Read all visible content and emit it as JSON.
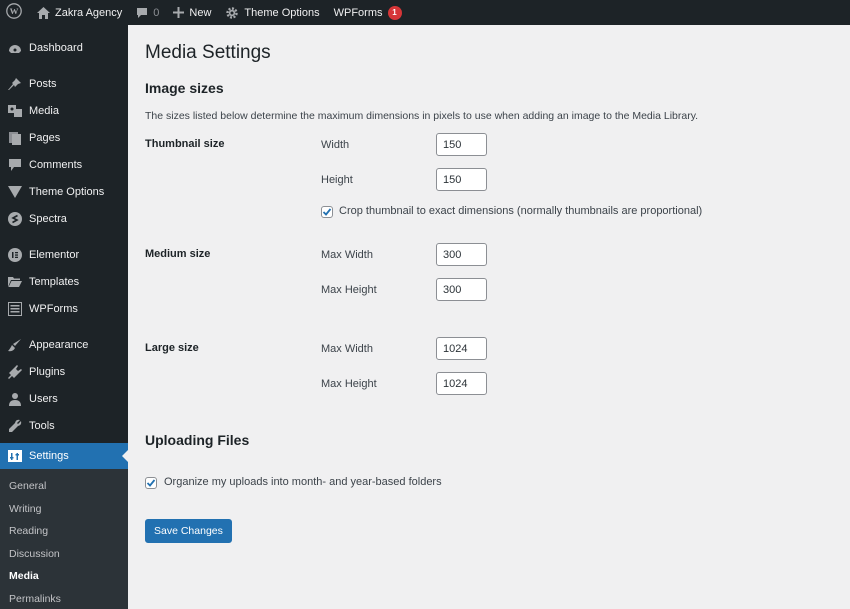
{
  "adminbar": {
    "site_name": "Zakra Agency",
    "comments_count": "0",
    "new_label": "New",
    "theme_options_label": "Theme Options",
    "wpforms_label": "WPForms",
    "wpforms_badge": "1"
  },
  "sidebar": {
    "items": [
      {
        "label": "Dashboard",
        "icon": "dashboard-icon"
      },
      {
        "label": "Posts",
        "icon": "pin-icon"
      },
      {
        "label": "Media",
        "icon": "media-icon"
      },
      {
        "label": "Pages",
        "icon": "pages-icon"
      },
      {
        "label": "Comments",
        "icon": "comment-icon"
      },
      {
        "label": "Theme Options",
        "icon": "triangle-icon"
      },
      {
        "label": "Spectra",
        "icon": "spectra-icon"
      },
      {
        "label": "Elementor",
        "icon": "elementor-icon"
      },
      {
        "label": "Templates",
        "icon": "folder-icon"
      },
      {
        "label": "WPForms",
        "icon": "form-icon"
      },
      {
        "label": "Appearance",
        "icon": "brush-icon"
      },
      {
        "label": "Plugins",
        "icon": "plug-icon"
      },
      {
        "label": "Users",
        "icon": "user-icon"
      },
      {
        "label": "Tools",
        "icon": "wrench-icon"
      },
      {
        "label": "Settings",
        "icon": "settings-icon"
      }
    ],
    "submenu": [
      "General",
      "Writing",
      "Reading",
      "Discussion",
      "Media",
      "Permalinks"
    ],
    "current_submenu": "Media"
  },
  "main": {
    "title": "Media Settings",
    "image_sizes_title": "Image sizes",
    "image_sizes_desc": "The sizes listed below determine the maximum dimensions in pixels to use when adding an image to the Media Library.",
    "thumbnail": {
      "label": "Thumbnail size",
      "width_label": "Width",
      "width": "150",
      "height_label": "Height",
      "height": "150",
      "crop_label": "Crop thumbnail to exact dimensions (normally thumbnails are proportional)",
      "crop_checked": true
    },
    "medium": {
      "label": "Medium size",
      "width_label": "Max Width",
      "width": "300",
      "height_label": "Max Height",
      "height": "300"
    },
    "large": {
      "label": "Large size",
      "width_label": "Max Width",
      "width": "1024",
      "height_label": "Max Height",
      "height": "1024"
    },
    "uploading_title": "Uploading Files",
    "organize_label": "Organize my uploads into month- and year-based folders",
    "organize_checked": true,
    "save_label": "Save Changes"
  },
  "colors": {
    "accent": "#2271b1",
    "adminbar_bg": "#1d2327",
    "badge": "#d63638"
  }
}
